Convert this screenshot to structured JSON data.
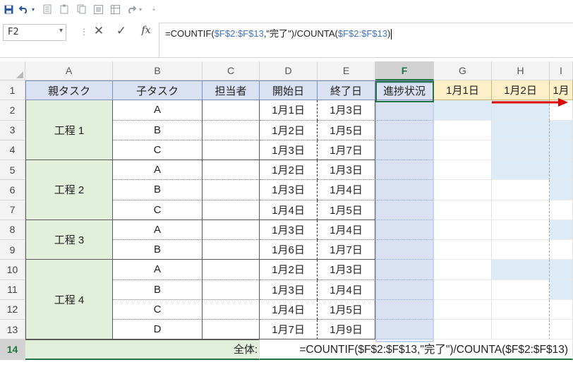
{
  "toolbar": {
    "icons": [
      "save-icon",
      "undo-icon",
      "undo-dropdown-icon",
      "sort-icon",
      "clipboard-icon",
      "copy-icon",
      "paste-icon",
      "form-icon",
      "select-icon",
      "redo-icon",
      "redo-dropdown-icon",
      "customize-icon"
    ]
  },
  "formula_bar": {
    "name_box": "F2",
    "formula_prefix": "=COUNTIF(",
    "formula_ref1": "$F$2:$F$13",
    "formula_mid": ",\"完了\")/COUNTA(",
    "formula_ref2": "$F$2:$F$13",
    "formula_suffix": ")",
    "fx": "fx"
  },
  "columns": [
    "A",
    "B",
    "C",
    "D",
    "E",
    "F",
    "G",
    "H",
    "I"
  ],
  "selected_column": "F",
  "rows": [
    "1",
    "2",
    "3",
    "4",
    "5",
    "6",
    "7",
    "8",
    "9",
    "10",
    "11",
    "12",
    "13",
    "14"
  ],
  "selected_row": "14",
  "header": {
    "parent": "親タスク",
    "child": "子タスク",
    "owner": "担当者",
    "start": "開始日",
    "end": "終了日",
    "progress": "進捗状況",
    "gantt_dates": [
      "1月1日",
      "1月2日",
      "1月"
    ]
  },
  "parents": [
    "工程 1",
    "工程 2",
    "工程 3",
    "工程 4"
  ],
  "tasks": [
    {
      "child": "A",
      "start": "1月1日",
      "end": "1月3日"
    },
    {
      "child": "B",
      "start": "1月2日",
      "end": "1月5日"
    },
    {
      "child": "C",
      "start": "1月3日",
      "end": "1月7日"
    },
    {
      "child": "A",
      "start": "1月2日",
      "end": "1月3日"
    },
    {
      "child": "B",
      "start": "1月3日",
      "end": "1月4日"
    },
    {
      "child": "C",
      "start": "1月4日",
      "end": "1月5日"
    },
    {
      "child": "A",
      "start": "1月3日",
      "end": "1月4日"
    },
    {
      "child": "B",
      "start": "1月6日",
      "end": "1月7日"
    },
    {
      "child": "A",
      "start": "1月2日",
      "end": "1月3日"
    },
    {
      "child": "B",
      "start": "1月3日",
      "end": "1月4日"
    },
    {
      "child": "C",
      "start": "1月4日",
      "end": "1月5日"
    },
    {
      "child": "D",
      "start": "1月7日",
      "end": "1月9日"
    }
  ],
  "total": {
    "label": "全体:",
    "formula": "=COUNTIF($F$2:$F$13,\"完了\")/COUNTA($F$2:$F$13)"
  },
  "colors": {
    "header_blue": "#dae1f3",
    "header_yellow": "#fdefc7",
    "parent_green": "#e2efda",
    "progress_blue": "#d9e1f2",
    "gantt_fill": "#ddebf7",
    "excel_green": "#217346",
    "arrow_red": "#e00000"
  }
}
